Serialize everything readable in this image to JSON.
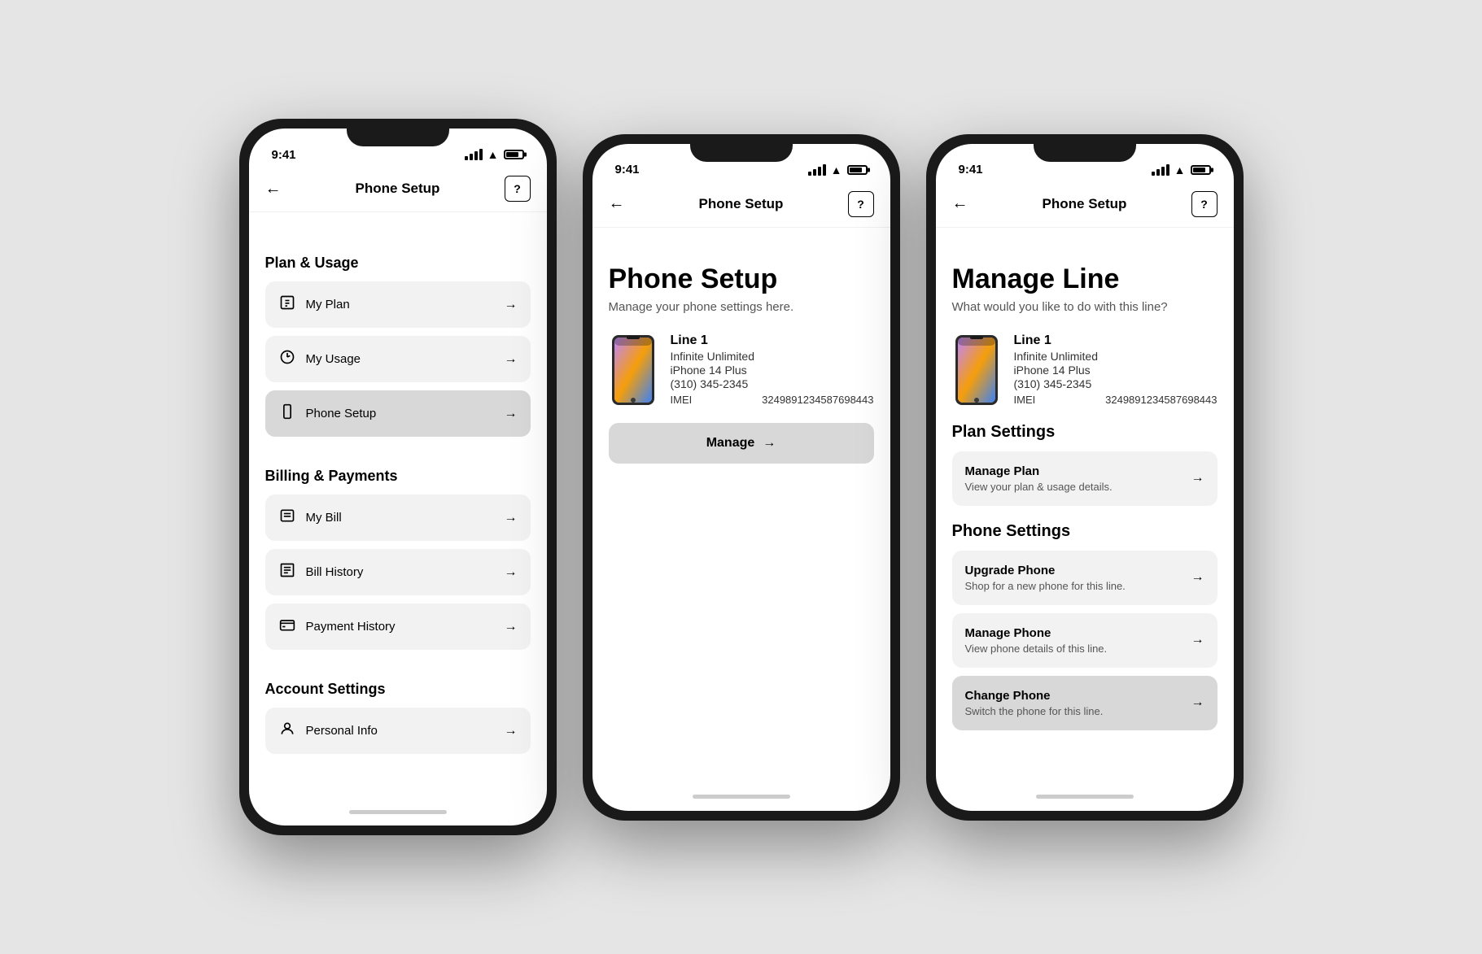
{
  "screens": [
    {
      "id": "screen1",
      "status_time": "9:41",
      "nav": {
        "back_label": "←",
        "title": "Phone Setup",
        "help_label": "?"
      },
      "sections": [
        {
          "id": "plan-usage",
          "header": "Plan & Usage",
          "items": [
            {
              "id": "my-plan",
              "icon": "📋",
              "label": "My Plan"
            },
            {
              "id": "my-usage",
              "icon": "🔄",
              "label": "My Usage"
            },
            {
              "id": "phone-setup",
              "icon": "📱",
              "label": "Phone Setup",
              "active": true
            }
          ]
        },
        {
          "id": "billing-payments",
          "header": "Billing & Payments",
          "items": [
            {
              "id": "my-bill",
              "icon": "🧾",
              "label": "My Bill"
            },
            {
              "id": "bill-history",
              "icon": "📄",
              "label": "Bill History"
            },
            {
              "id": "payment-history",
              "icon": "💳",
              "label": "Payment History"
            }
          ]
        },
        {
          "id": "account-settings",
          "header": "Account Settings",
          "items": [
            {
              "id": "personal-info",
              "icon": "👤",
              "label": "Personal Info"
            }
          ]
        }
      ]
    },
    {
      "id": "screen2",
      "status_time": "9:41",
      "nav": {
        "back_label": "←",
        "title": "Phone Setup",
        "help_label": "?"
      },
      "page_title": "Phone Setup",
      "page_subtitle": "Manage your phone settings here.",
      "line": {
        "name": "Line 1",
        "plan": "Infinite Unlimited",
        "device": "iPhone 14 Plus",
        "phone": "(310) 345-2345",
        "imei_label": "IMEI",
        "imei_value": "3249891234587698443"
      },
      "manage_button": "Manage"
    },
    {
      "id": "screen3",
      "status_time": "9:41",
      "nav": {
        "back_label": "←",
        "title": "Phone Setup",
        "help_label": "?"
      },
      "page_title": "Manage Line",
      "page_subtitle": "What would you like to do with this line?",
      "line": {
        "name": "Line 1",
        "plan": "Infinite Unlimited",
        "device": "iPhone 14 Plus",
        "phone": "(310) 345-2345",
        "imei_label": "IMEI",
        "imei_value": "3249891234587698443"
      },
      "plan_settings": {
        "header": "Plan Settings",
        "items": [
          {
            "id": "manage-plan",
            "title": "Manage Plan",
            "desc": "View your plan & usage details."
          }
        ]
      },
      "phone_settings": {
        "header": "Phone Settings",
        "items": [
          {
            "id": "upgrade-phone",
            "title": "Upgrade Phone",
            "desc": "Shop for a new phone for this line.",
            "active": false
          },
          {
            "id": "manage-phone",
            "title": "Manage Phone",
            "desc": "View phone details of this line.",
            "active": false
          },
          {
            "id": "change-phone",
            "title": "Change Phone",
            "desc": "Switch the phone for this line.",
            "active": true
          }
        ]
      }
    }
  ]
}
